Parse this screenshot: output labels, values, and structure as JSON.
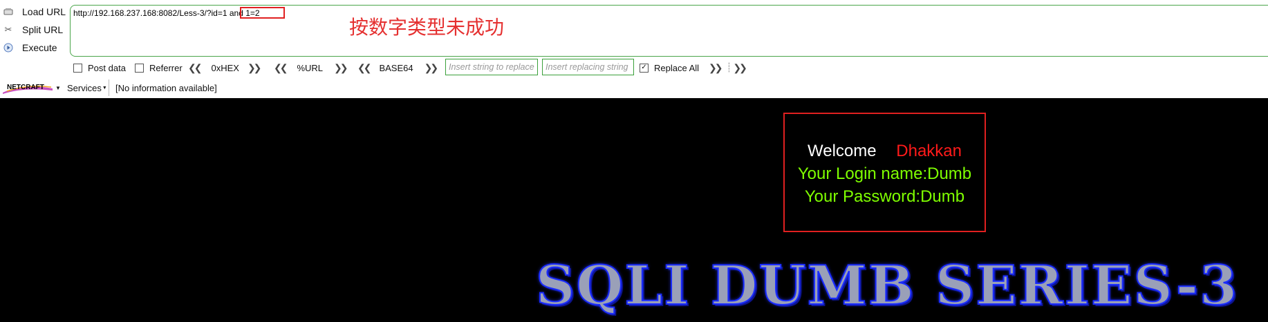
{
  "toolbar": {
    "load_url": "Load URL",
    "split_url": "Split URL",
    "execute": "Execute",
    "url": "http://192.168.237.168:8082/Less-3/?id=1 and 1=2",
    "annotation": "按数字类型未成功",
    "post_data": "Post data",
    "referrer": "Referrer",
    "hex": "0xHEX",
    "url_enc": "%URL",
    "base64": "BASE64",
    "insert_placeholder": "Insert string to replace",
    "replacing_placeholder": "Insert replacing string",
    "replace_all": "Replace All",
    "netcraft": "NETCRAFT",
    "services": "Services",
    "info": "[No information available]"
  },
  "page": {
    "welcome": "Welcome",
    "user": "Dhakkan",
    "login_name": "Your Login name:Dumb",
    "password": "Your Password:Dumb",
    "banner": "SQLI DUMB SERIES-3"
  },
  "colors": {
    "accent_green": "#3aa03a",
    "highlight_red": "#e02020",
    "page_green": "#7fff00",
    "banner_blue": "#1a2cff"
  }
}
